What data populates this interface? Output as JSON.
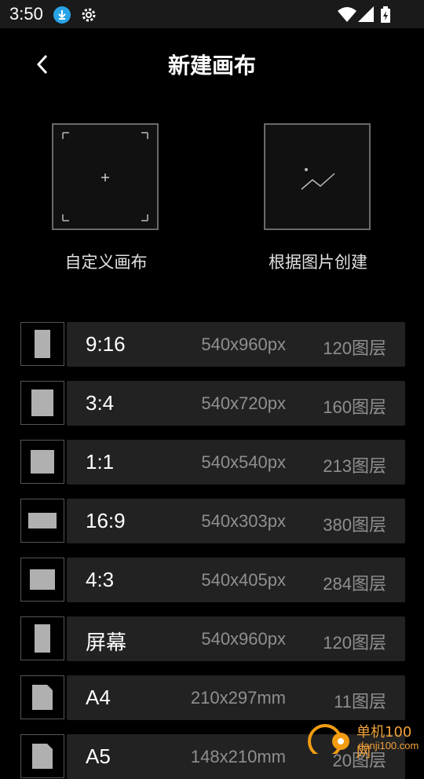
{
  "status": {
    "time": "3:50"
  },
  "header": {
    "title": "新建画布"
  },
  "options": {
    "custom_label": "自定义画布",
    "from_image_label": "根据图片创建"
  },
  "presets": [
    {
      "ratio": "9:16",
      "size": "540x960px",
      "layers": "120图层",
      "shape": "portrait"
    },
    {
      "ratio": "3:4",
      "size": "540x720px",
      "layers": "160图层",
      "shape": "portrait-wide"
    },
    {
      "ratio": "1:1",
      "size": "540x540px",
      "layers": "213图层",
      "shape": "square"
    },
    {
      "ratio": "16:9",
      "size": "540x303px",
      "layers": "380图层",
      "shape": "landscape"
    },
    {
      "ratio": "4:3",
      "size": "540x405px",
      "layers": "284图层",
      "shape": "landscape-narrow"
    },
    {
      "ratio": "屏幕",
      "size": "540x960px",
      "layers": "120图层",
      "shape": "portrait"
    },
    {
      "ratio": "A4",
      "size": "210x297mm",
      "layers": "11图层",
      "shape": "document"
    },
    {
      "ratio": "A5",
      "size": "148x210mm",
      "layers": "20图层",
      "shape": "document"
    }
  ],
  "watermark": {
    "text": "单机100网",
    "url_text": "danji100.com"
  }
}
